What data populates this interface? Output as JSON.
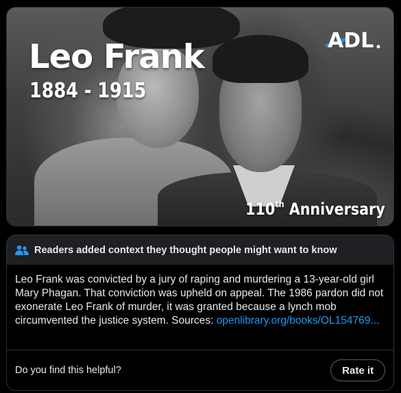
{
  "media": {
    "title": "Leo Frank",
    "years": "1884 - 1915",
    "logo_text": "ADL",
    "anniversary_number": "110",
    "anniversary_suffix": "th",
    "anniversary_word": "Anniversary"
  },
  "note": {
    "header_icon": "people-icon",
    "header_text": "Readers added context they thought people might want to know",
    "body_text": "Leo Frank was convicted by a jury of raping and murdering a 13-year-old girl Mary Phagan. That conviction was upheld on appeal. The 1986 pardon did not exonerate Leo Frank of murder, it was granted because a lynch mob circumvented the justice system. Sources: ",
    "source_link": "openlibrary.org/books/OL154769...",
    "helpful_question": "Do you find this helpful?",
    "rate_button": "Rate it"
  },
  "colors": {
    "link": "#1d9bf0",
    "header_bg": "#1e2023",
    "border": "#2f3336",
    "logo_accent": "#1d8fe0"
  }
}
